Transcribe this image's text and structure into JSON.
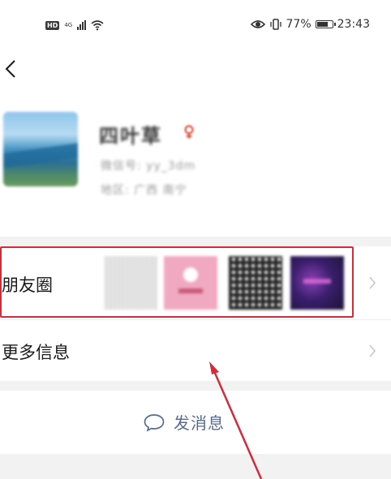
{
  "status_bar": {
    "hd": "HD",
    "network": "4G",
    "battery_percent": "77%",
    "battery_level": 0.77,
    "time": "23:43"
  },
  "profile": {
    "name": "四叶草",
    "wechat_id": "微信号: yy_3dm",
    "region": "地区: 广西 南宁",
    "sex_icon": "female-icon"
  },
  "moments_row": {
    "label": "朋友圈",
    "thumbnail_count": 4
  },
  "more_info_row": {
    "label": "更多信息"
  },
  "send_message": {
    "label": "发消息",
    "icon": "chat-bubble-icon"
  },
  "colors": {
    "highlight_border": "#d42a3a",
    "arrow": "#d42a3a",
    "link_blue": "#576b95",
    "section_gap": "#f2f2f2"
  }
}
